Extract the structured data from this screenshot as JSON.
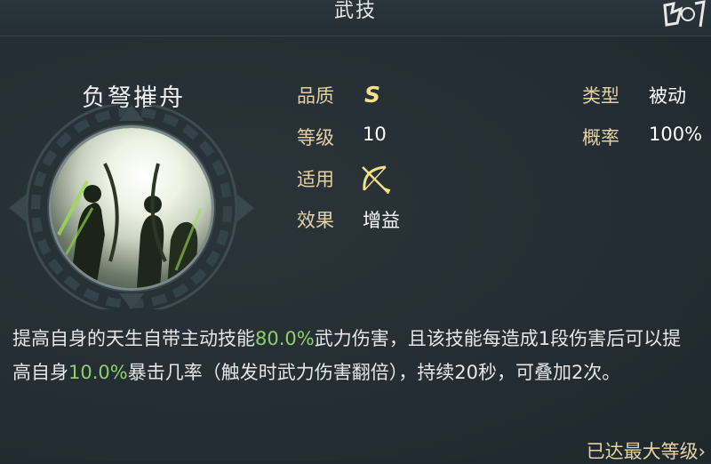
{
  "header": {
    "title": "武技"
  },
  "skill": {
    "name": "负弩摧舟",
    "attributes": {
      "quality_label": "品质",
      "quality_value": "S",
      "level_label": "等级",
      "level_value": "10",
      "applicable_label": "适用",
      "applicable_icon": "bow-icon",
      "effect_label": "效果",
      "effect_value": "增益",
      "type_label": "类型",
      "type_value": "被动",
      "rate_label": "概率",
      "rate_value": "100%"
    },
    "description": {
      "part1": "提高自身的天生自带主动技能",
      "value1": "80.0%",
      "part2": "武力伤害，且该技能每造成1段伤害后可以提高自身",
      "value2": "10.0%",
      "part3": "暴击几率（触发时武力伤害翻倍），持续20秒，可叠加2次。"
    }
  },
  "footer": {
    "status": "已达最大等级",
    "chevron": "›"
  },
  "colors": {
    "highlight": "#8fd06a",
    "label": "#e4d2a4",
    "grade": "#f4df8a"
  }
}
